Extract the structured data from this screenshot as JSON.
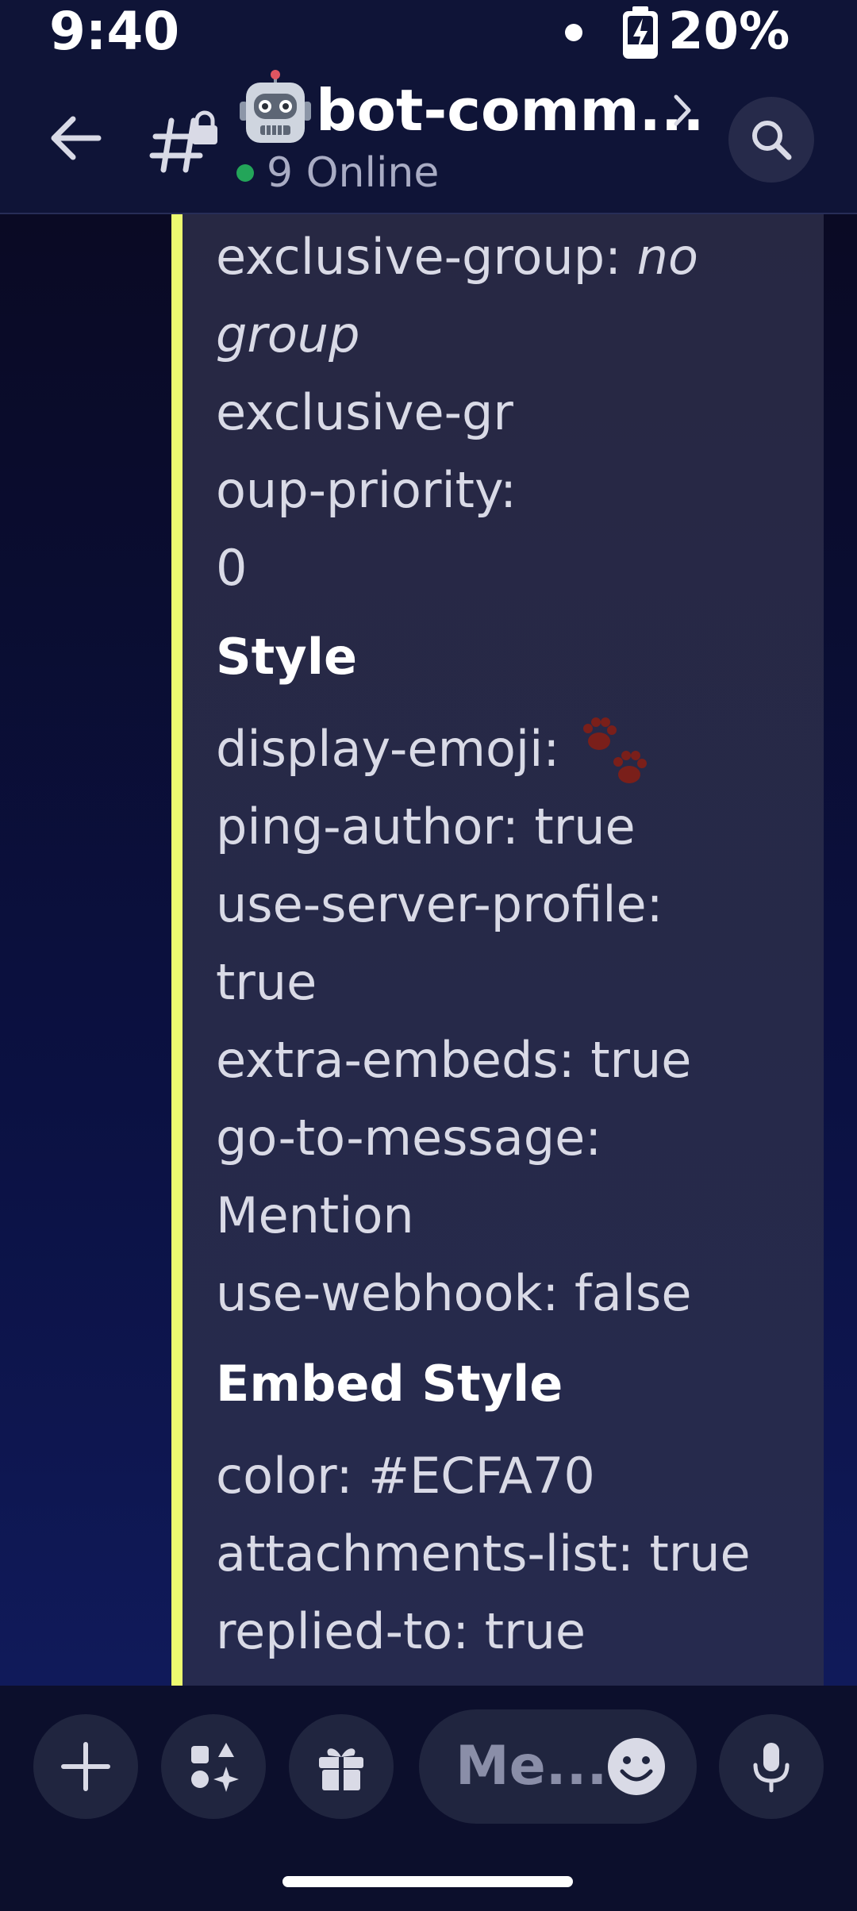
{
  "status_bar": {
    "time": "9:40",
    "battery": "20%"
  },
  "header": {
    "channel_name": "bot-comm...",
    "online": "9 Online",
    "online_color": "#23a559"
  },
  "embed": {
    "accent_color": "#ECFA70",
    "lines": [
      {
        "kind": "text",
        "key": "exclusive-group: ",
        "value": "no"
      },
      {
        "kind": "text",
        "key": "",
        "value": "group"
      },
      {
        "kind": "text",
        "key": "exclusive-gr",
        "value": ""
      },
      {
        "kind": "text",
        "key": "oup-priority:",
        "value": ""
      },
      {
        "kind": "text",
        "key": "0",
        "value": ""
      }
    ],
    "style_heading": "Style",
    "style_lines": {
      "display_emoji": "display-emoji:",
      "ping_author": "ping-author: true",
      "use_server_profile": "use-server-profile:",
      "use_server_profile_value": "true",
      "extra_embeds": "extra-embeds: true",
      "go_to_message": "go-to-message:",
      "go_to_message_value": "Mention",
      "use_webhook": "use-webhook: false"
    },
    "embed_style_heading": "Embed Style",
    "embed_style_lines": {
      "color": "color: #ECFA70",
      "attachments_list": "attachments-list: true",
      "replied_to": "replied-to: true"
    },
    "icons": {
      "display_emoji": "paw-prints-icon"
    }
  },
  "footer": {
    "message_placeholder": "Me..."
  }
}
